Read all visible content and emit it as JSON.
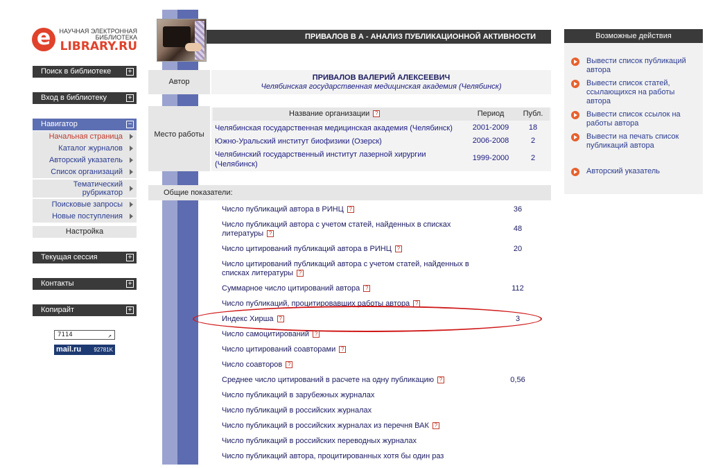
{
  "logo": {
    "letter": "e",
    "subtitle": "НАУЧНАЯ ЭЛЕКТРОННАЯ БИБЛИОТЕКА",
    "name": "LIBRARY.RU",
    "brand_color": "#e0422b"
  },
  "sidebar": {
    "search": "Поиск в библиотеке",
    "login": "Вход в библиотеку",
    "navigator": "Навигатор",
    "nav_items": [
      "Начальная страница",
      "Каталог журналов",
      "Авторский указатель",
      "Список организаций",
      "Тематический рубрикатор",
      "Поисковые запросы",
      "Новые поступления"
    ],
    "settings": "Настройка",
    "session": "Текущая сессия",
    "contacts": "Контакты",
    "copyright": "Копирайт",
    "counter": "7114",
    "mailru_logo": "mail.ru",
    "mailru_count": "92781K"
  },
  "header": {
    "title": "ПРИВАЛОВ В А - АНАЛИЗ ПУБЛИКАЦИОННОЙ АКТИВНОСТИ"
  },
  "author": {
    "label": "Автор",
    "name": "ПРИВАЛОВ ВАЛЕРИЙ АЛЕКСЕЕВИЧ",
    "org": "Челябинская государственная медицинская академия (Челябинск)"
  },
  "work": {
    "label": "Место работы",
    "columns": [
      "Название организации",
      "Период",
      "Публ."
    ],
    "rows": [
      {
        "org": "Челябинская государственная медицинская академия (Челябинск)",
        "period": "2001-2009",
        "count": "18"
      },
      {
        "org": "Южно-Уральский институт биофизики (Озерск)",
        "period": "2006-2008",
        "count": "2"
      },
      {
        "org": "Челябинский государственный институт лазерной хирургии (Челябинск)",
        "period": "1999-2000",
        "count": "2"
      }
    ]
  },
  "indicators": {
    "heading": "Общие показатели:",
    "help": "?",
    "items": [
      {
        "label": "Число публикаций автора в РИНЦ",
        "value": "36"
      },
      {
        "label": "Число публикаций автора с учетом статей, найденных в списках литературы",
        "value": "48"
      },
      {
        "label": "Число цитирований публикаций автора в РИНЦ",
        "value": "20"
      },
      {
        "label": "Число цитирований публикаций автора с учетом статей, найденных в списках литературы",
        "value": ""
      },
      {
        "label": "Суммарное число цитирований автора",
        "value": "112"
      },
      {
        "label": "Число публикаций, процитировавших работы автора",
        "value": ""
      },
      {
        "label": "Индекс Хирша",
        "value": "3"
      },
      {
        "label": "Число самоцитирований",
        "value": ""
      },
      {
        "label": "Число цитирований соавторами",
        "value": ""
      },
      {
        "label": "Число соавторов",
        "value": ""
      },
      {
        "label": "Среднее число цитирований в расчете на одну публикацию",
        "value": "0,56"
      },
      {
        "label": "Число публикаций в зарубежных журналах",
        "value": ""
      },
      {
        "label": "Число публикаций в российских журналах",
        "value": ""
      },
      {
        "label": "Число публикаций в российских журналах из перечня ВАК",
        "value": ""
      },
      {
        "label": "Число публикаций в российских переводных журналах",
        "value": ""
      },
      {
        "label": "Число публикаций автора, процитированных хотя бы один раз",
        "value": ""
      }
    ]
  },
  "actions": {
    "heading": "Возможные действия",
    "items": [
      "Вывести список публикаций автора",
      "Вывести список статей, ссылающихся на работы автора",
      "Вывести список ссылок на работы автора",
      "Вывести на печать список публикаций автора",
      "Авторский указатель"
    ]
  },
  "colors": {
    "menu_dark": "#3a3a3a",
    "navigator": "#5d6fb3",
    "link": "#2a3b8f",
    "highlight_ellipse": "#d01818"
  }
}
